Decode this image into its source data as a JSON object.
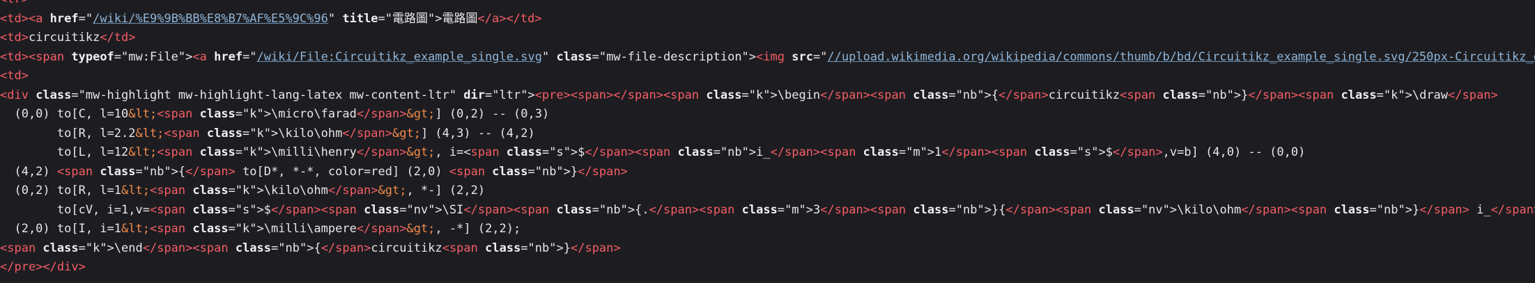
{
  "colors": {
    "background": "#1d1d21",
    "tag": "#f55d65",
    "attribute": "#f0f0f2",
    "string": "#dcdcdf",
    "link": "#8fb5d9",
    "text": "#e8e8ea",
    "entity": "#f28a4a"
  },
  "source_lines": [
    [
      {
        "k": "tag",
        "v": "<tr>"
      }
    ],
    [
      {
        "k": "tag",
        "v": "<td>"
      },
      {
        "k": "tag",
        "v": "<a "
      },
      {
        "k": "attr",
        "v": "href"
      },
      {
        "k": "text",
        "v": "=\""
      },
      {
        "k": "link",
        "v": "/wiki/%E9%9B%BB%E8%B7%AF%E5%9C%96"
      },
      {
        "k": "text",
        "v": "\" "
      },
      {
        "k": "attr",
        "v": "title"
      },
      {
        "k": "text",
        "v": "=\"電路圖\">"
      },
      {
        "k": "text",
        "v": "電路圖"
      },
      {
        "k": "tag",
        "v": "</a>"
      },
      {
        "k": "tag",
        "v": "</td>"
      }
    ],
    [
      {
        "k": "tag",
        "v": "<td>"
      },
      {
        "k": "text",
        "v": "circuitikz"
      },
      {
        "k": "tag",
        "v": "</td>"
      }
    ],
    [
      {
        "k": "tag",
        "v": "<td>"
      },
      {
        "k": "tag",
        "v": "<span "
      },
      {
        "k": "attr",
        "v": "typeof"
      },
      {
        "k": "text",
        "v": "=\"mw:File\">"
      },
      {
        "k": "tag",
        "v": "<a "
      },
      {
        "k": "attr",
        "v": "href"
      },
      {
        "k": "text",
        "v": "=\""
      },
      {
        "k": "link",
        "v": "/wiki/File:Circuitikz_example_single.svg"
      },
      {
        "k": "text",
        "v": "\" "
      },
      {
        "k": "attr",
        "v": "class"
      },
      {
        "k": "text",
        "v": "=\"mw-file-description\">"
      },
      {
        "k": "tag",
        "v": "<img "
      },
      {
        "k": "attr",
        "v": "src"
      },
      {
        "k": "text",
        "v": "=\""
      },
      {
        "k": "link",
        "v": "//upload.wikimedia.org/wikipedia/commons/thumb/b/bd/Circuitikz_example_single.svg/250px-Circuitikz_example_single.svg.png"
      },
      {
        "k": "text",
        "v": "\" d"
      }
    ],
    [
      {
        "k": "tag",
        "v": "<td>"
      }
    ],
    [
      {
        "k": "tag",
        "v": "<div "
      },
      {
        "k": "attr",
        "v": "class"
      },
      {
        "k": "text",
        "v": "=\"mw-highlight mw-highlight-lang-latex mw-content-ltr\" "
      },
      {
        "k": "attr",
        "v": "dir"
      },
      {
        "k": "text",
        "v": "=\"ltr\">"
      },
      {
        "k": "tag",
        "v": "<pre>"
      },
      {
        "k": "tag",
        "v": "<span>"
      },
      {
        "k": "tag",
        "v": "</span>"
      },
      {
        "k": "tag",
        "v": "<span "
      },
      {
        "k": "attr",
        "v": "class"
      },
      {
        "k": "text",
        "v": "=\"k\">"
      },
      {
        "k": "text",
        "v": "\\begin"
      },
      {
        "k": "tag",
        "v": "</span>"
      },
      {
        "k": "tag",
        "v": "<span "
      },
      {
        "k": "attr",
        "v": "class"
      },
      {
        "k": "text",
        "v": "=\"nb\">"
      },
      {
        "k": "text",
        "v": "{"
      },
      {
        "k": "tag",
        "v": "</span>"
      },
      {
        "k": "text",
        "v": "circuitikz"
      },
      {
        "k": "tag",
        "v": "<span "
      },
      {
        "k": "attr",
        "v": "class"
      },
      {
        "k": "text",
        "v": "=\"nb\">"
      },
      {
        "k": "text",
        "v": "}"
      },
      {
        "k": "tag",
        "v": "</span>"
      },
      {
        "k": "tag",
        "v": "<span "
      },
      {
        "k": "attr",
        "v": "class"
      },
      {
        "k": "text",
        "v": "=\"k\">"
      },
      {
        "k": "text",
        "v": "\\draw"
      },
      {
        "k": "tag",
        "v": "</span>"
      }
    ],
    [
      {
        "k": "text",
        "v": "  (0,0) to[C, l=10"
      },
      {
        "k": "ent",
        "v": "&lt;"
      },
      {
        "k": "tag",
        "v": "<span "
      },
      {
        "k": "attr",
        "v": "class"
      },
      {
        "k": "text",
        "v": "=\"k\">"
      },
      {
        "k": "text",
        "v": "\\micro\\farad"
      },
      {
        "k": "tag",
        "v": "</span>"
      },
      {
        "k": "ent",
        "v": "&gt;"
      },
      {
        "k": "text",
        "v": "] (0,2) -- (0,3)"
      }
    ],
    [
      {
        "k": "text",
        "v": "        to[R, l=2.2"
      },
      {
        "k": "ent",
        "v": "&lt;"
      },
      {
        "k": "tag",
        "v": "<span "
      },
      {
        "k": "attr",
        "v": "class"
      },
      {
        "k": "text",
        "v": "=\"k\">"
      },
      {
        "k": "text",
        "v": "\\kilo\\ohm"
      },
      {
        "k": "tag",
        "v": "</span>"
      },
      {
        "k": "ent",
        "v": "&gt;"
      },
      {
        "k": "text",
        "v": "] (4,3) -- (4,2)"
      }
    ],
    [
      {
        "k": "text",
        "v": "        to[L, l=12"
      },
      {
        "k": "ent",
        "v": "&lt;"
      },
      {
        "k": "tag",
        "v": "<span "
      },
      {
        "k": "attr",
        "v": "class"
      },
      {
        "k": "text",
        "v": "=\"k\">"
      },
      {
        "k": "text",
        "v": "\\milli\\henry"
      },
      {
        "k": "tag",
        "v": "</span>"
      },
      {
        "k": "ent",
        "v": "&gt;"
      },
      {
        "k": "text",
        "v": ", i=<"
      },
      {
        "k": "tag",
        "v": "span "
      },
      {
        "k": "attr",
        "v": "class"
      },
      {
        "k": "text",
        "v": "=\"s\">"
      },
      {
        "k": "text",
        "v": "$"
      },
      {
        "k": "tag",
        "v": "</span>"
      },
      {
        "k": "tag",
        "v": "<span "
      },
      {
        "k": "attr",
        "v": "class"
      },
      {
        "k": "text",
        "v": "=\"nb\">"
      },
      {
        "k": "text",
        "v": "i_"
      },
      {
        "k": "tag",
        "v": "</span>"
      },
      {
        "k": "tag",
        "v": "<span "
      },
      {
        "k": "attr",
        "v": "class"
      },
      {
        "k": "text",
        "v": "=\"m\">"
      },
      {
        "k": "text",
        "v": "1"
      },
      {
        "k": "tag",
        "v": "</span>"
      },
      {
        "k": "tag",
        "v": "<span "
      },
      {
        "k": "attr",
        "v": "class"
      },
      {
        "k": "text",
        "v": "=\"s\">"
      },
      {
        "k": "text",
        "v": "$"
      },
      {
        "k": "tag",
        "v": "</span>"
      },
      {
        "k": "text",
        "v": ",v=b] (4,0) -- (0,0)"
      }
    ],
    [
      {
        "k": "text",
        "v": "  (4,2) "
      },
      {
        "k": "tag",
        "v": "<span "
      },
      {
        "k": "attr",
        "v": "class"
      },
      {
        "k": "text",
        "v": "=\"nb\">"
      },
      {
        "k": "text",
        "v": "{"
      },
      {
        "k": "tag",
        "v": "</span>"
      },
      {
        "k": "text",
        "v": " to[D*, *-*, color=red] (2,0) "
      },
      {
        "k": "tag",
        "v": "<span "
      },
      {
        "k": "attr",
        "v": "class"
      },
      {
        "k": "text",
        "v": "=\"nb\">"
      },
      {
        "k": "text",
        "v": "}"
      },
      {
        "k": "tag",
        "v": "</span>"
      }
    ],
    [
      {
        "k": "text",
        "v": "  (0,2) to[R, l=1"
      },
      {
        "k": "ent",
        "v": "&lt;"
      },
      {
        "k": "tag",
        "v": "<span "
      },
      {
        "k": "attr",
        "v": "class"
      },
      {
        "k": "text",
        "v": "=\"k\">"
      },
      {
        "k": "text",
        "v": "\\kilo\\ohm"
      },
      {
        "k": "tag",
        "v": "</span>"
      },
      {
        "k": "ent",
        "v": "&gt;"
      },
      {
        "k": "text",
        "v": ", *-] (2,2)"
      }
    ],
    [
      {
        "k": "text",
        "v": "        to[cV, i=1,v="
      },
      {
        "k": "tag",
        "v": "<span "
      },
      {
        "k": "attr",
        "v": "class"
      },
      {
        "k": "text",
        "v": "=\"s\">"
      },
      {
        "k": "text",
        "v": "$"
      },
      {
        "k": "tag",
        "v": "</span>"
      },
      {
        "k": "tag",
        "v": "<span "
      },
      {
        "k": "attr",
        "v": "class"
      },
      {
        "k": "text",
        "v": "=\"nv\">"
      },
      {
        "k": "text",
        "v": "\\SI"
      },
      {
        "k": "tag",
        "v": "</span>"
      },
      {
        "k": "tag",
        "v": "<span "
      },
      {
        "k": "attr",
        "v": "class"
      },
      {
        "k": "text",
        "v": "=\"nb\">"
      },
      {
        "k": "text",
        "v": "{."
      },
      {
        "k": "tag",
        "v": "</span>"
      },
      {
        "k": "tag",
        "v": "<span "
      },
      {
        "k": "attr",
        "v": "class"
      },
      {
        "k": "text",
        "v": "=\"m\">"
      },
      {
        "k": "text",
        "v": "3"
      },
      {
        "k": "tag",
        "v": "</span>"
      },
      {
        "k": "tag",
        "v": "<span "
      },
      {
        "k": "attr",
        "v": "class"
      },
      {
        "k": "text",
        "v": "=\"nb\">"
      },
      {
        "k": "text",
        "v": "}{"
      },
      {
        "k": "tag",
        "v": "</span>"
      },
      {
        "k": "tag",
        "v": "<span "
      },
      {
        "k": "attr",
        "v": "class"
      },
      {
        "k": "text",
        "v": "=\"nv\">"
      },
      {
        "k": "text",
        "v": "\\kilo\\ohm"
      },
      {
        "k": "tag",
        "v": "</span>"
      },
      {
        "k": "tag",
        "v": "<span "
      },
      {
        "k": "attr",
        "v": "class"
      },
      {
        "k": "text",
        "v": "=\"nb\">"
      },
      {
        "k": "text",
        "v": "}"
      },
      {
        "k": "tag",
        "v": "</span>"
      },
      {
        "k": "text",
        "v": " i_"
      },
      {
        "k": "tag",
        "v": "</span>"
      },
      {
        "k": "tag",
        "v": "<span "
      },
      {
        "k": "attr",
        "v": "class"
      },
      {
        "k": "text",
        "v": "=\"m\">"
      },
      {
        "k": "text",
        "v": "1"
      },
      {
        "k": "tag",
        "v": "</span>"
      },
      {
        "k": "tag",
        "v": "<span "
      },
      {
        "k": "attr",
        "v": "class"
      },
      {
        "k": "text",
        "v": "=\"c"
      }
    ],
    [
      {
        "k": "text",
        "v": "  (2,0) to[I, i=1"
      },
      {
        "k": "ent",
        "v": "&lt;"
      },
      {
        "k": "tag",
        "v": "<span "
      },
      {
        "k": "attr",
        "v": "class"
      },
      {
        "k": "text",
        "v": "=\"k\">"
      },
      {
        "k": "text",
        "v": "\\milli\\ampere"
      },
      {
        "k": "tag",
        "v": "</span>"
      },
      {
        "k": "ent",
        "v": "&gt;"
      },
      {
        "k": "text",
        "v": ", -*] (2,2);"
      }
    ],
    [
      {
        "k": "tag",
        "v": "<span "
      },
      {
        "k": "attr",
        "v": "class"
      },
      {
        "k": "text",
        "v": "=\"k\">"
      },
      {
        "k": "text",
        "v": "\\end"
      },
      {
        "k": "tag",
        "v": "</span>"
      },
      {
        "k": "tag",
        "v": "<span "
      },
      {
        "k": "attr",
        "v": "class"
      },
      {
        "k": "text",
        "v": "=\"nb\">"
      },
      {
        "k": "text",
        "v": "{"
      },
      {
        "k": "tag",
        "v": "</span>"
      },
      {
        "k": "text",
        "v": "circuitikz"
      },
      {
        "k": "tag",
        "v": "<span "
      },
      {
        "k": "attr",
        "v": "class"
      },
      {
        "k": "text",
        "v": "=\"nb\">"
      },
      {
        "k": "text",
        "v": "}"
      },
      {
        "k": "tag",
        "v": "</span>"
      }
    ],
    [
      {
        "k": "tag",
        "v": "</pre>"
      },
      {
        "k": "tag",
        "v": "</div>"
      }
    ]
  ]
}
